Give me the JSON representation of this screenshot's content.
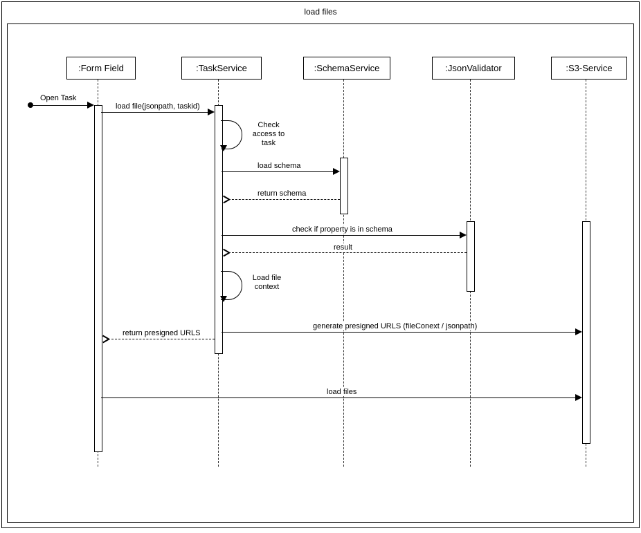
{
  "title": "load files",
  "participants": {
    "formField": ":Form Field",
    "taskService": ":TaskService",
    "schemaService": ":SchemaService",
    "jsonValidator": ":JsonValidator",
    "s3Service": ":S3-Service"
  },
  "messages": {
    "openTask": "Open Task",
    "loadFile": "load file(jsonpath, taskid)",
    "checkAccess": "Check access to task",
    "loadSchema": "load schema",
    "returnSchema": "return schema",
    "checkProperty": "check if property is in schema",
    "result": "result",
    "loadFileContext": "Load file context",
    "generatePresigned": "generate presigned URLS (fileConext / jsonpath)",
    "returnPresigned": "return presigned URLS",
    "loadFiles": "load files"
  },
  "chart_data": {
    "type": "sequence-diagram",
    "title": "load files",
    "participants": [
      ":Form Field",
      ":TaskService",
      ":SchemaService",
      ":JsonValidator",
      ":S3-Service"
    ],
    "messages": [
      {
        "from": "found",
        "to": ":Form Field",
        "label": "Open Task",
        "type": "sync"
      },
      {
        "from": ":Form Field",
        "to": ":TaskService",
        "label": "load file(jsonpath, taskid)",
        "type": "sync"
      },
      {
        "from": ":TaskService",
        "to": ":TaskService",
        "label": "Check access to task",
        "type": "self"
      },
      {
        "from": ":TaskService",
        "to": ":SchemaService",
        "label": "load schema",
        "type": "sync"
      },
      {
        "from": ":SchemaService",
        "to": ":TaskService",
        "label": "return schema",
        "type": "return"
      },
      {
        "from": ":TaskService",
        "to": ":JsonValidator",
        "label": "check if property is in schema",
        "type": "sync"
      },
      {
        "from": ":JsonValidator",
        "to": ":TaskService",
        "label": "result",
        "type": "return"
      },
      {
        "from": ":TaskService",
        "to": ":TaskService",
        "label": "Load file context",
        "type": "self"
      },
      {
        "from": ":TaskService",
        "to": ":S3-Service",
        "label": "generate presigned URLS (fileConext / jsonpath)",
        "type": "sync"
      },
      {
        "from": ":TaskService",
        "to": ":Form Field",
        "label": "return presigned URLS",
        "type": "return"
      },
      {
        "from": ":Form Field",
        "to": ":S3-Service",
        "label": "load files",
        "type": "sync"
      }
    ]
  }
}
